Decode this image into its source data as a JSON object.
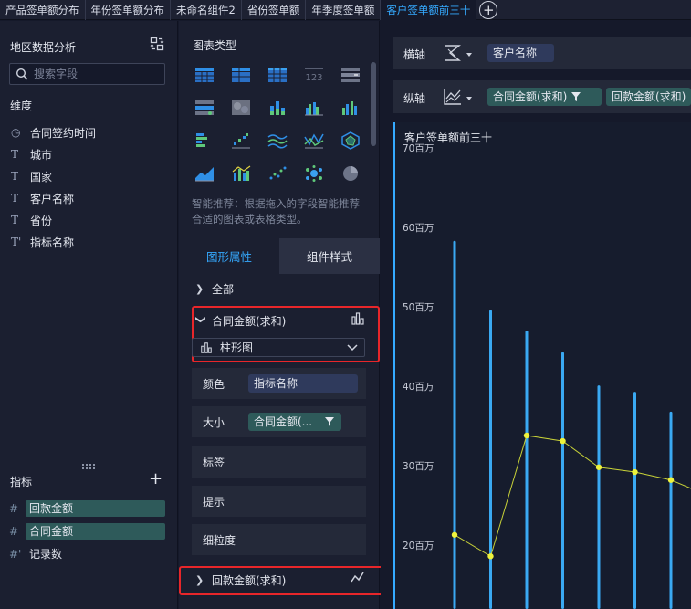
{
  "tabs": [
    {
      "label": "产品签单额分布",
      "active": false
    },
    {
      "label": "年份签单额分布",
      "active": false
    },
    {
      "label": "未命名组件2",
      "active": false
    },
    {
      "label": "省份签单额",
      "active": false
    },
    {
      "label": "年季度签单额",
      "active": false
    },
    {
      "label": "客户签单额前三十",
      "active": true
    }
  ],
  "data_panel": {
    "title": "地区数据分析",
    "search_placeholder": "搜索字段",
    "dimension_label": "维度",
    "dimensions": [
      {
        "icon": "clock-icon",
        "glyph": "◷",
        "label": "合同签约时间"
      },
      {
        "icon": "text-type-icon",
        "glyph": "T",
        "label": "城市"
      },
      {
        "icon": "text-type-icon",
        "glyph": "T",
        "label": "国家"
      },
      {
        "icon": "text-type-icon",
        "glyph": "T",
        "label": "客户名称"
      },
      {
        "icon": "text-type-icon",
        "glyph": "T",
        "label": "省份"
      },
      {
        "icon": "text-calc-type-icon",
        "glyph": "T'",
        "label": "指标名称"
      }
    ],
    "measure_label": "指标",
    "measures": [
      {
        "glyph": "#",
        "label": "回款金额",
        "highlight": true
      },
      {
        "glyph": "#",
        "label": "合同金额",
        "highlight": true
      },
      {
        "glyph": "#'",
        "label": "记录数",
        "highlight": false
      }
    ]
  },
  "config_panel": {
    "chart_type_title": "图表类型",
    "hint": "智能推荐：根据拖入的字段智能推荐合适的图表或表格类型。",
    "tabs": {
      "graphic": "图形属性",
      "component": "组件样式"
    },
    "all_label": "全部",
    "series1": {
      "label": "合同金额(求和)",
      "chart_type": "柱形图"
    },
    "props": {
      "color_label": "颜色",
      "color_value": "指标名称",
      "size_label": "大小",
      "size_value": "合同金额(...",
      "label_label": "标签",
      "tooltip_label": "提示",
      "granularity_label": "细粒度"
    },
    "series2": {
      "label": "回款金额(求和)"
    }
  },
  "axes": {
    "x_label": "横轴",
    "x_field": "客户名称",
    "y_label": "纵轴",
    "y_fields": [
      "合同金额(求和)",
      "回款金额(求和)"
    ]
  },
  "colors": {
    "accent": "#35aaff",
    "bar": "#3aa9f2",
    "line": "#c8d238",
    "highlight_box": "#e8262a"
  },
  "chart_data": {
    "type": "bar",
    "title": "客户签单额前三十",
    "ylim": [
      16,
      70
    ],
    "y_ticks": [
      "20百万",
      "30百万",
      "40百万",
      "50百万",
      "60百万",
      "70百万"
    ],
    "y_tick_values": [
      20,
      30,
      40,
      50,
      60,
      70
    ],
    "series": [
      {
        "values": [
          59,
          50.3,
          47.7,
          45,
          40.8,
          40,
          37.5
        ]
      },
      {
        "values": [
          22,
          19.3,
          34.5,
          33.8,
          30.5,
          29.9,
          28.9,
          27
        ]
      }
    ]
  }
}
